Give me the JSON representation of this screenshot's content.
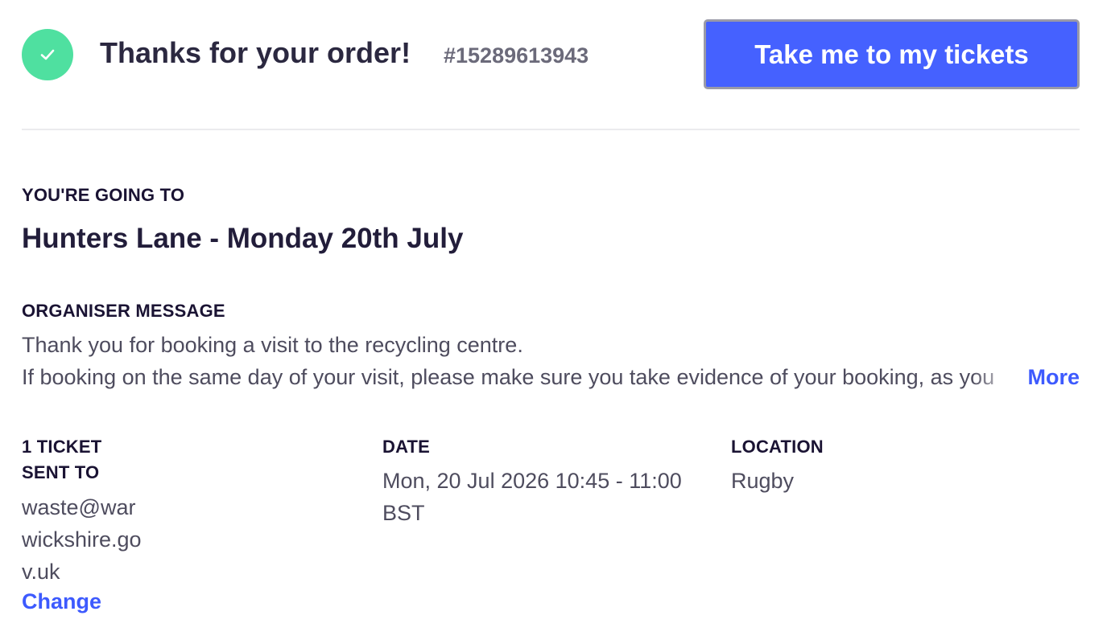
{
  "header": {
    "title": "Thanks for your order!",
    "order_number": "#15289613943",
    "tickets_button": "Take me to my tickets",
    "check_icon": "checkmark-icon",
    "accent_color": "#4fe0a0",
    "button_color": "#4561ff"
  },
  "event": {
    "going_label": "YOU'RE GOING TO",
    "title": "Hunters Lane - Monday 20th July"
  },
  "organiser": {
    "label": "ORGANISER MESSAGE",
    "line1": "Thank you for booking a visit to the recycling centre.",
    "line2": "If booking on the same day of your visit, please make sure you take evidence of your booking, as you",
    "more_link": "More"
  },
  "details": {
    "ticket_label_line1": "1 TICKET",
    "ticket_label_line2": "SENT TO",
    "email": "waste@warwickshire.gov.uk",
    "change_link": "Change",
    "date_label": "DATE",
    "date_value": "Mon, 20 Jul 2026 10:45 - 11:00 BST",
    "location_label": "LOCATION",
    "location_value": "Rugby"
  },
  "link_color": "#3d5afe"
}
